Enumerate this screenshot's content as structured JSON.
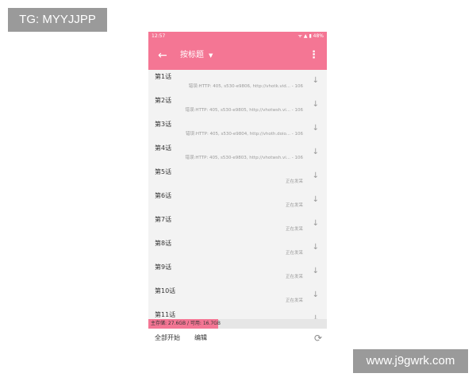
{
  "watermarks": {
    "top_left": "TG: MYYJJPP",
    "bottom_right": "www.j9gwrk.com"
  },
  "status_bar": {
    "time": "12:57",
    "icons": "ᯤ ▲ ▮ 48%"
  },
  "app_bar": {
    "back_icon": "←",
    "title": "按标题",
    "caret_icon": "▼",
    "more_icon": "⋮"
  },
  "episodes": [
    {
      "name": "第1话",
      "status": "错误:HTTP: 405, s530-e9806, http://vhotk.vid... - 106"
    },
    {
      "name": "第2话",
      "status": "错误:HTTP: 405, s530-e9805, http://vhotwsh.vi... - 106"
    },
    {
      "name": "第3话",
      "status": "错误:HTTP: 405, s530-e9804, http://vhoth.doio... - 106"
    },
    {
      "name": "第4话",
      "status": "错误:HTTP: 405, s530-e9803, http://vhotwsh.vi... - 106"
    },
    {
      "name": "第5话",
      "status": "正在发呆"
    },
    {
      "name": "第6话",
      "status": "正在发呆"
    },
    {
      "name": "第7话",
      "status": "正在发呆"
    },
    {
      "name": "第8话",
      "status": "正在发呆"
    },
    {
      "name": "第9话",
      "status": "正在发呆"
    },
    {
      "name": "第10话",
      "status": "正在发呆"
    },
    {
      "name": "第11话",
      "status": ""
    }
  ],
  "download_icon": "↓",
  "storage": {
    "text": "主存储: 27.6GB  / 可用: 16.7GB",
    "used_fraction": 0.39
  },
  "bottom_bar": {
    "start_all": "全部开始",
    "edit": "编辑",
    "refresh_icon": "⟳"
  }
}
